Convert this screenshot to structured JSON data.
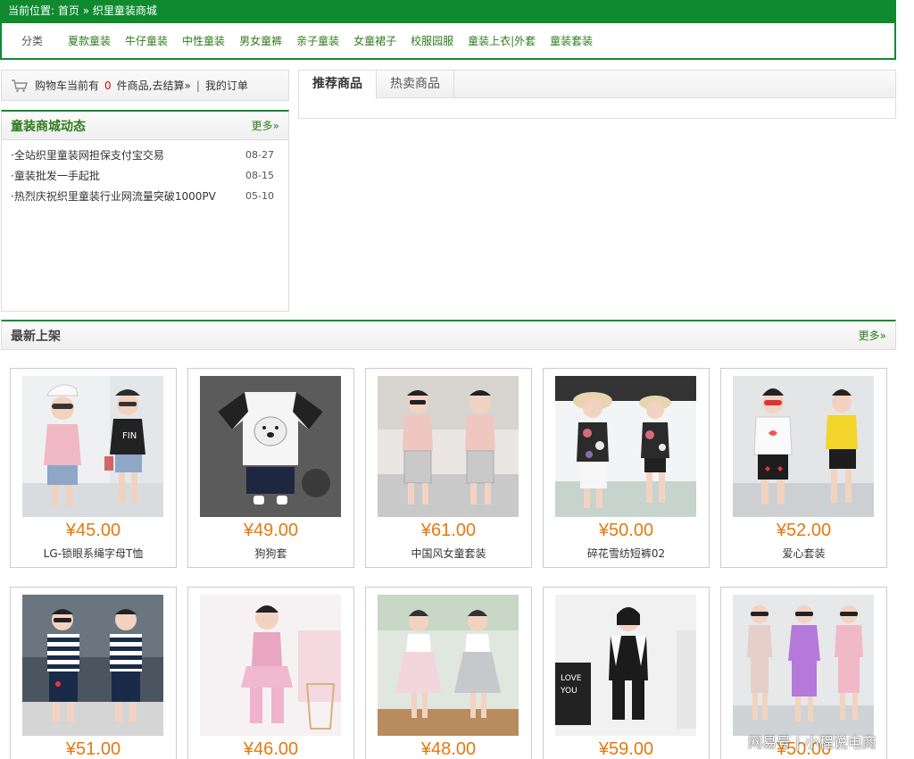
{
  "breadcrumb": {
    "label": "当前位置:",
    "home": "首页",
    "separator": "»",
    "current": "织里童装商城"
  },
  "categories": {
    "label": "分类",
    "items": [
      "夏款童装",
      "牛仔童装",
      "中性童装",
      "男女童裤",
      "亲子童装",
      "女童裙子",
      "校服园服",
      "童装上衣|外套",
      "童装套装"
    ]
  },
  "cart": {
    "prefix": "购物车当前有",
    "count": "0",
    "suffix": "件商品,",
    "checkout": "去结算»",
    "divider": "|",
    "orders": "我的订单"
  },
  "news": {
    "title": "童装商城动态",
    "more": "更多»",
    "items": [
      {
        "title": "·全站织里童装网担保支付宝交易",
        "date": "08-27"
      },
      {
        "title": "·童装批发一手起批",
        "date": "08-15"
      },
      {
        "title": "·热烈庆祝织里童装行业网流量突破1000PV",
        "date": "05-10"
      }
    ]
  },
  "tabs": [
    "推荐商品",
    "热卖商品"
  ],
  "newest": {
    "title": "最新上架",
    "more": "更多»"
  },
  "products": [
    {
      "price": "¥45.00",
      "name": "LG-锁眼系绳字母T恤",
      "img": "girls-cap-outfit"
    },
    {
      "price": "¥49.00",
      "name": "狗狗套",
      "img": "dog-shirt-set"
    },
    {
      "price": "¥61.00",
      "name": "中国风女童套装",
      "img": "chinese-style-set"
    },
    {
      "price": "¥50.00",
      "name": "碎花雪纺短裤02",
      "img": "floral-chiffon-set"
    },
    {
      "price": "¥52.00",
      "name": "爱心套装",
      "img": "heart-set"
    },
    {
      "price": "¥51.00",
      "name": "",
      "img": "striped-boys"
    },
    {
      "price": "¥46.00",
      "name": "",
      "img": "pink-dress"
    },
    {
      "price": "¥48.00",
      "name": "",
      "img": "tulle-dresses"
    },
    {
      "price": "¥59.00",
      "name": "",
      "img": "black-white-set"
    },
    {
      "price": "¥50.00",
      "name": "",
      "img": "purple-sets"
    }
  ],
  "watermark": "网易号 | 小程说电商",
  "colors": {
    "brand_green": "#0f8a2f",
    "link_green": "#2f7a1e",
    "price_orange": "#e4790f",
    "cart_red": "#ee0000"
  }
}
